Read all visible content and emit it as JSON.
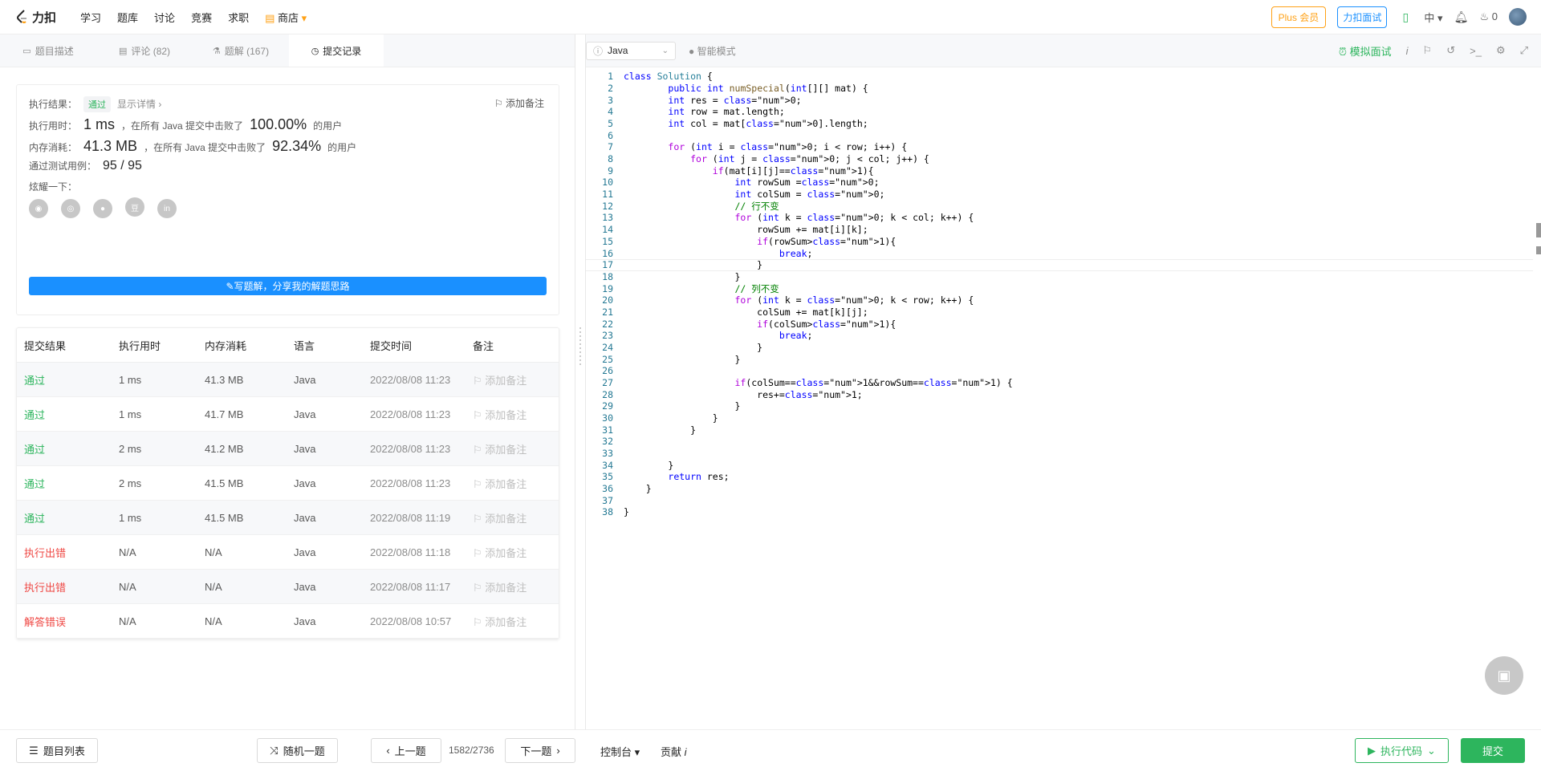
{
  "nav": {
    "logo_text": "力扣",
    "links": [
      "学习",
      "题库",
      "讨论",
      "竞赛",
      "求职"
    ],
    "shop": "商店",
    "plus": "Plus 会员",
    "interview": "力扣面试",
    "lang": "中",
    "coins": "0"
  },
  "tabs": [
    {
      "label": "题目描述",
      "icon": "doc-icon"
    },
    {
      "label": "评论 (82)",
      "icon": "comment-icon"
    },
    {
      "label": "题解 (167)",
      "icon": "flask-icon"
    },
    {
      "label": "提交记录",
      "icon": "clock-icon"
    }
  ],
  "result": {
    "status_label": "执行结果：",
    "status": "通过",
    "show_detail": "显示详情 ›",
    "add_note": "添加备注",
    "runtime_label": "执行用时：",
    "runtime": "1 ms",
    "runtime_mid": "，在所有 Java 提交中击败了",
    "runtime_pct": "100.00%",
    "runtime_tail": "的用户",
    "memory_label": "内存消耗：",
    "memory": "41.3 MB",
    "memory_mid": "，在所有 Java 提交中击败了",
    "memory_pct": "92.34%",
    "memory_tail": "的用户",
    "tests_label": "通过测试用例：",
    "tests": "95 / 95",
    "share_label": "炫耀一下：",
    "share_btn": "写题解，分享我的解题思路"
  },
  "table": {
    "headers": [
      "提交结果",
      "执行用时",
      "内存消耗",
      "语言",
      "提交时间",
      "备注"
    ],
    "rows": [
      {
        "result": "通过",
        "time": "1 ms",
        "mem": "41.3 MB",
        "lang": "Java",
        "date": "2022/08/08 11:23",
        "note": "添加备注",
        "status": "ok"
      },
      {
        "result": "通过",
        "time": "1 ms",
        "mem": "41.7 MB",
        "lang": "Java",
        "date": "2022/08/08 11:23",
        "note": "添加备注",
        "status": "ok"
      },
      {
        "result": "通过",
        "time": "2 ms",
        "mem": "41.2 MB",
        "lang": "Java",
        "date": "2022/08/08 11:23",
        "note": "添加备注",
        "status": "ok"
      },
      {
        "result": "通过",
        "time": "2 ms",
        "mem": "41.5 MB",
        "lang": "Java",
        "date": "2022/08/08 11:23",
        "note": "添加备注",
        "status": "ok"
      },
      {
        "result": "通过",
        "time": "1 ms",
        "mem": "41.5 MB",
        "lang": "Java",
        "date": "2022/08/08 11:19",
        "note": "添加备注",
        "status": "ok"
      },
      {
        "result": "执行出错",
        "time": "N/A",
        "mem": "N/A",
        "lang": "Java",
        "date": "2022/08/08 11:18",
        "note": "添加备注",
        "status": "err"
      },
      {
        "result": "执行出错",
        "time": "N/A",
        "mem": "N/A",
        "lang": "Java",
        "date": "2022/08/08 11:17",
        "note": "添加备注",
        "status": "err"
      },
      {
        "result": "解答错误",
        "time": "N/A",
        "mem": "N/A",
        "lang": "Java",
        "date": "2022/08/08 10:57",
        "note": "添加备注",
        "status": "err"
      }
    ]
  },
  "editor": {
    "language": "Java",
    "smart_mode": "智能模式",
    "mock_interview": "模拟面试",
    "code_lines": [
      "class Solution {",
      "        public int numSpecial(int[][] mat) {",
      "        int res = 0;",
      "        int row = mat.length;",
      "        int col = mat[0].length;",
      "",
      "        for (int i = 0; i < row; i++) {",
      "            for (int j = 0; j < col; j++) {",
      "                if(mat[i][j]==1){",
      "                    int rowSum =0;",
      "                    int colSum = 0;",
      "                    // 行不变",
      "                    for (int k = 0; k < col; k++) {",
      "                        rowSum += mat[i][k];",
      "                        if(rowSum>1){",
      "                            break;",
      "                        }",
      "                    }",
      "                    // 列不变",
      "                    for (int k = 0; k < row; k++) {",
      "                        colSum += mat[k][j];",
      "                        if(colSum>1){",
      "                            break;",
      "                        }",
      "                    }",
      "",
      "                    if(colSum==1&&rowSum==1) {",
      "                        res+=1;",
      "                    }",
      "                }",
      "            }",
      "",
      "",
      "        }",
      "        return res;",
      "    }",
      "",
      "}"
    ]
  },
  "footer": {
    "problem_list": "题目列表",
    "random": "随机一题",
    "prev": "上一题",
    "count": "1582/2736",
    "next": "下一题",
    "console": "控制台",
    "contribute": "贡献",
    "run": "执行代码",
    "submit": "提交"
  }
}
